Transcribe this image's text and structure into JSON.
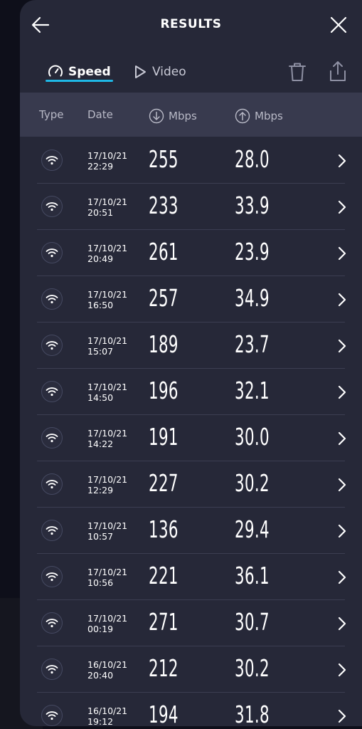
{
  "header": {
    "title": "RESULTS"
  },
  "tabs": [
    {
      "label": "Speed",
      "active": true
    },
    {
      "label": "Video",
      "active": false
    }
  ],
  "columns": {
    "type": "Type",
    "date": "Date",
    "download": "Mbps",
    "upload": "Mbps"
  },
  "colors": {
    "panel": "#262838",
    "header_row": "#383a4e",
    "accent": "#1fb8e6"
  },
  "rows": [
    {
      "type": "wifi",
      "date": "17/10/21",
      "time": "22:29",
      "download": "255",
      "upload": "28.0"
    },
    {
      "type": "wifi",
      "date": "17/10/21",
      "time": "20:51",
      "download": "233",
      "upload": "33.9"
    },
    {
      "type": "wifi",
      "date": "17/10/21",
      "time": "20:49",
      "download": "261",
      "upload": "23.9"
    },
    {
      "type": "wifi",
      "date": "17/10/21",
      "time": "16:50",
      "download": "257",
      "upload": "34.9"
    },
    {
      "type": "wifi",
      "date": "17/10/21",
      "time": "15:07",
      "download": "189",
      "upload": "23.7"
    },
    {
      "type": "wifi",
      "date": "17/10/21",
      "time": "14:50",
      "download": "196",
      "upload": "32.1"
    },
    {
      "type": "wifi",
      "date": "17/10/21",
      "time": "14:22",
      "download": "191",
      "upload": "30.0"
    },
    {
      "type": "wifi",
      "date": "17/10/21",
      "time": "12:29",
      "download": "227",
      "upload": "30.2"
    },
    {
      "type": "wifi",
      "date": "17/10/21",
      "time": "10:57",
      "download": "136",
      "upload": "29.4"
    },
    {
      "type": "wifi",
      "date": "17/10/21",
      "time": "10:56",
      "download": "221",
      "upload": "36.1"
    },
    {
      "type": "wifi",
      "date": "17/10/21",
      "time": "00:19",
      "download": "271",
      "upload": "30.7"
    },
    {
      "type": "wifi",
      "date": "16/10/21",
      "time": "20:40",
      "download": "212",
      "upload": "30.2"
    },
    {
      "type": "wifi",
      "date": "16/10/21",
      "time": "19:12",
      "download": "194",
      "upload": "31.8"
    }
  ]
}
